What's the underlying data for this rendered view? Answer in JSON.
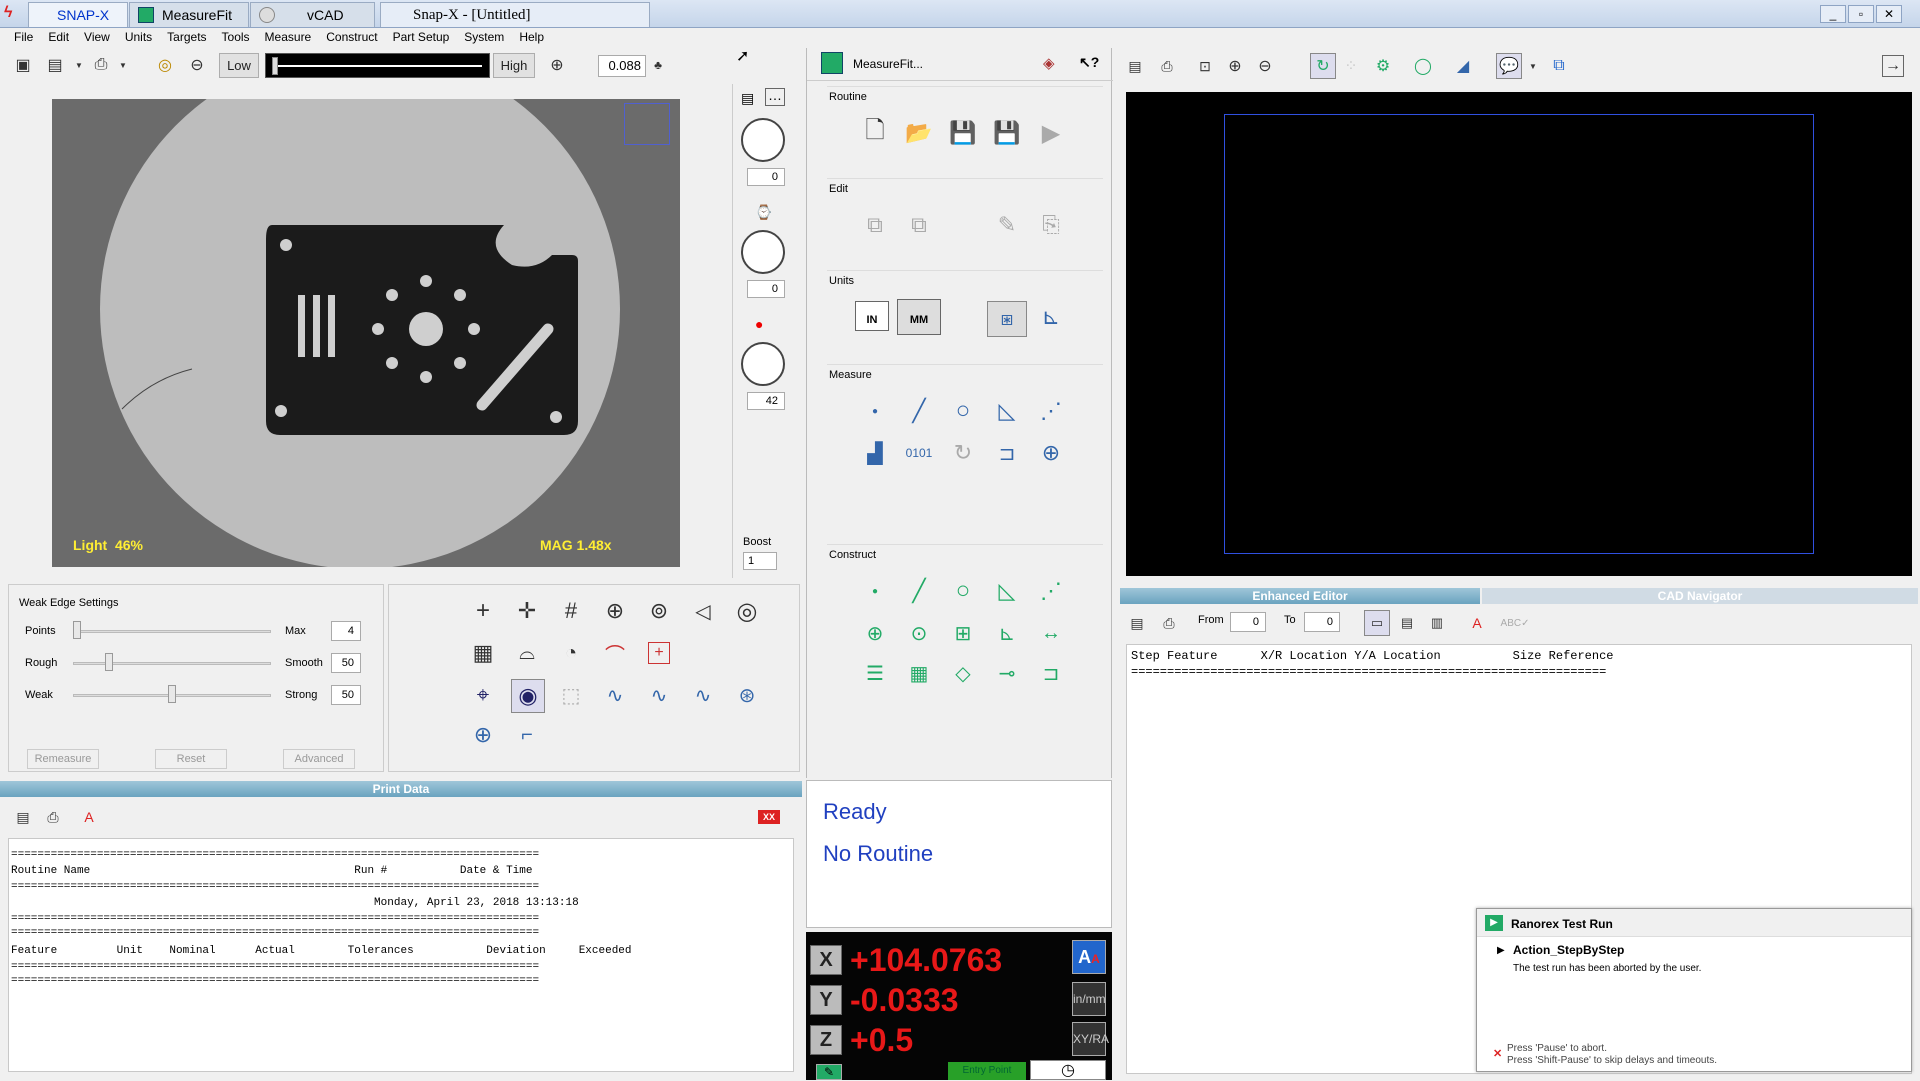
{
  "window": {
    "tabs": [
      "SNAP-X",
      "MeasureFit",
      "vCAD"
    ],
    "title": "Snap-X - [Untitled]"
  },
  "menu": [
    "File",
    "Edit",
    "View",
    "Units",
    "Targets",
    "Tools",
    "Measure",
    "Construct",
    "Part Setup",
    "System",
    "Help"
  ],
  "toolbar": {
    "low": "Low",
    "high": "High",
    "zoom_value": "0.088"
  },
  "camera": {
    "light": "Light  46%",
    "mag": "MAG 1.48x"
  },
  "side_values": {
    "v1": "0",
    "v2": "0",
    "v3": "42",
    "boost_label": "Boost",
    "boost_value": "1"
  },
  "edge": {
    "title": "Weak Edge Settings",
    "rows": [
      {
        "left": "Points",
        "right": "Max",
        "value": "4",
        "pos": 0.05
      },
      {
        "left": "Rough",
        "right": "Smooth",
        "value": "50",
        "pos": 0.2
      },
      {
        "left": "Weak",
        "right": "Strong",
        "value": "50",
        "pos": 0.5
      }
    ],
    "buttons": [
      "Remeasure",
      "Reset",
      "Advanced"
    ]
  },
  "print": {
    "header": "Print Data",
    "rule": "================================================================================",
    "routine_line": "Routine Name                                        Run #           Date & Time",
    "date_line": "                                                       Monday, April 23, 2018 13:13:18",
    "feature_line": "Feature         Unit    Nominal      Actual        Tolerances           Deviation     Exceeded",
    "xx": "XX"
  },
  "measurefit": {
    "title": "MeasureFit...",
    "sections": [
      "Routine",
      "Edit",
      "Units",
      "Measure",
      "Construct"
    ],
    "in": "IN",
    "mm": "MM"
  },
  "status": {
    "ready": "Ready",
    "routine": "No Routine"
  },
  "dro": {
    "x_label": "X",
    "x": "+104.0763",
    "y_label": "Y",
    "y": "-0.0333",
    "z_label": "Z",
    "z": "+0.5",
    "entry": "Entry Point"
  },
  "editor": {
    "tab1": "Enhanced Editor",
    "tab2": "CAD Navigator",
    "from_label": "From",
    "from": "0",
    "to_label": "To",
    "to": "0",
    "columns": "Step Feature      X/R Location Y/A Location          Size Reference",
    "rule": "=================================================================="
  },
  "ranorex": {
    "title": "Ranorex Test Run",
    "action": "Action_StepByStep",
    "message": "The test run has been aborted by the user.",
    "hint1": "Press 'Pause' to abort.",
    "hint2": "Press 'Shift-Pause' to skip delays and timeouts."
  }
}
